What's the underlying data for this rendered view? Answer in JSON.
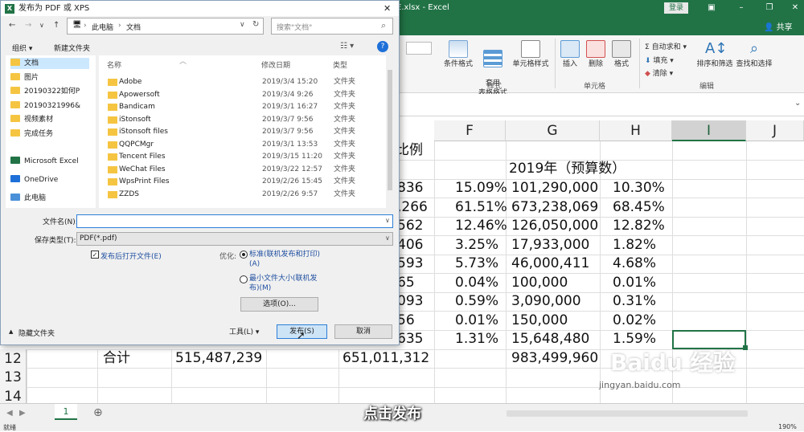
{
  "excel": {
    "title": "E.xlsx  -  Excel",
    "login": "登录",
    "share": "共享",
    "ribbon": {
      "cond_format": "条件格式",
      "table_format": "套用\n表格格式",
      "cell_style": "单元格样式",
      "style_group": "样式",
      "insert": "插入",
      "delete": "删除",
      "format": "格式",
      "cell_group": "单元格",
      "autosum": "自动求和",
      "fill": "填充",
      "clear": "清除",
      "sort_filter": "排序和筛选",
      "find_select": "查找和选择",
      "edit_group": "编辑"
    },
    "columns": [
      "F",
      "G",
      "H",
      "I",
      "J"
    ],
    "header_partial": "比例",
    "header_2019": "2019年（预算数）",
    "rows": [
      {
        "e": "836",
        "f": "15.09%",
        "g": "101,290,000",
        "h": "10.30%"
      },
      {
        "e": ",266",
        "f": "61.51%",
        "g": "673,238,069",
        "h": "68.45%"
      },
      {
        "e": "562",
        "f": "12.46%",
        "g": "126,050,000",
        "h": "12.82%"
      },
      {
        "e": "406",
        "f": "3.25%",
        "g": "17,933,000",
        "h": "1.82%"
      },
      {
        "e": "593",
        "f": "5.73%",
        "g": "46,000,411",
        "h": "4.68%"
      },
      {
        "e": "65",
        "f": "0.04%",
        "g": "100,000",
        "h": "0.01%"
      },
      {
        "e": "093",
        "f": "0.59%",
        "g": "3,090,000",
        "h": "0.31%"
      },
      {
        "e": "56",
        "f": "0.01%",
        "g": "150,000",
        "h": "0.02%"
      },
      {
        "e": "635",
        "f": "1.31%",
        "g": "15,648,480",
        "h": "1.59%"
      }
    ],
    "row12": {
      "num": "12",
      "b": "合计",
      "c": "515,487,239",
      "e": "651,011,312",
      "g": "983,499,960"
    },
    "row13": "13",
    "row14": "14",
    "sheet_tab": "1",
    "status_left": "就绪",
    "zoom": "190%"
  },
  "dialog": {
    "title": "发布为 PDF 或 XPS",
    "path": [
      "此电脑",
      "文档"
    ],
    "search_placeholder": "搜索\"文档\"",
    "organize": "组织 ▾",
    "new_folder": "新建文件夹",
    "nav_items": [
      "文档",
      "图片",
      "20190322如何P",
      "20190321996&",
      "视频素材",
      "完成任务",
      "Microsoft Excel",
      "OneDrive",
      "此电脑"
    ],
    "col_name": "名称",
    "col_date": "修改日期",
    "col_type": "类型",
    "files": [
      {
        "name": "Adobe",
        "date": "2019/3/4 15:20",
        "type": "文件夹"
      },
      {
        "name": "Apowersoft",
        "date": "2019/3/4 9:26",
        "type": "文件夹"
      },
      {
        "name": "Bandicam",
        "date": "2019/3/1 16:27",
        "type": "文件夹"
      },
      {
        "name": "iStonsoft",
        "date": "2019/3/7 9:56",
        "type": "文件夹"
      },
      {
        "name": "iStonsoft files",
        "date": "2019/3/7 9:56",
        "type": "文件夹"
      },
      {
        "name": "QQPCMgr",
        "date": "2019/3/1 13:53",
        "type": "文件夹"
      },
      {
        "name": "Tencent Files",
        "date": "2019/3/15 11:20",
        "type": "文件夹"
      },
      {
        "name": "WeChat Files",
        "date": "2019/3/22 12:57",
        "type": "文件夹"
      },
      {
        "name": "WpsPrint Files",
        "date": "2019/2/26 15:45",
        "type": "文件夹"
      },
      {
        "name": "ZZDS",
        "date": "2019/2/26 9:57",
        "type": "文件夹"
      }
    ],
    "filename_label": "文件名(N):",
    "filename_value": "",
    "filetype_label": "保存类型(T):",
    "filetype_value": "PDF(*.pdf)",
    "open_after": "发布后打开文件(E)",
    "optimize_label": "优化:",
    "opt_standard": "标准(联机发布和打印)\n(A)",
    "opt_min": "最小文件大小(联机发\n布)(M)",
    "options_btn": "选项(O)...",
    "hide_folders": "隐藏文件夹",
    "tools": "工具(L)",
    "publish": "发布(S)",
    "cancel": "取消"
  },
  "overlay": {
    "watermark": "Baidu 经验",
    "url": "jingyan.baidu.com",
    "caption": "点击发布"
  }
}
